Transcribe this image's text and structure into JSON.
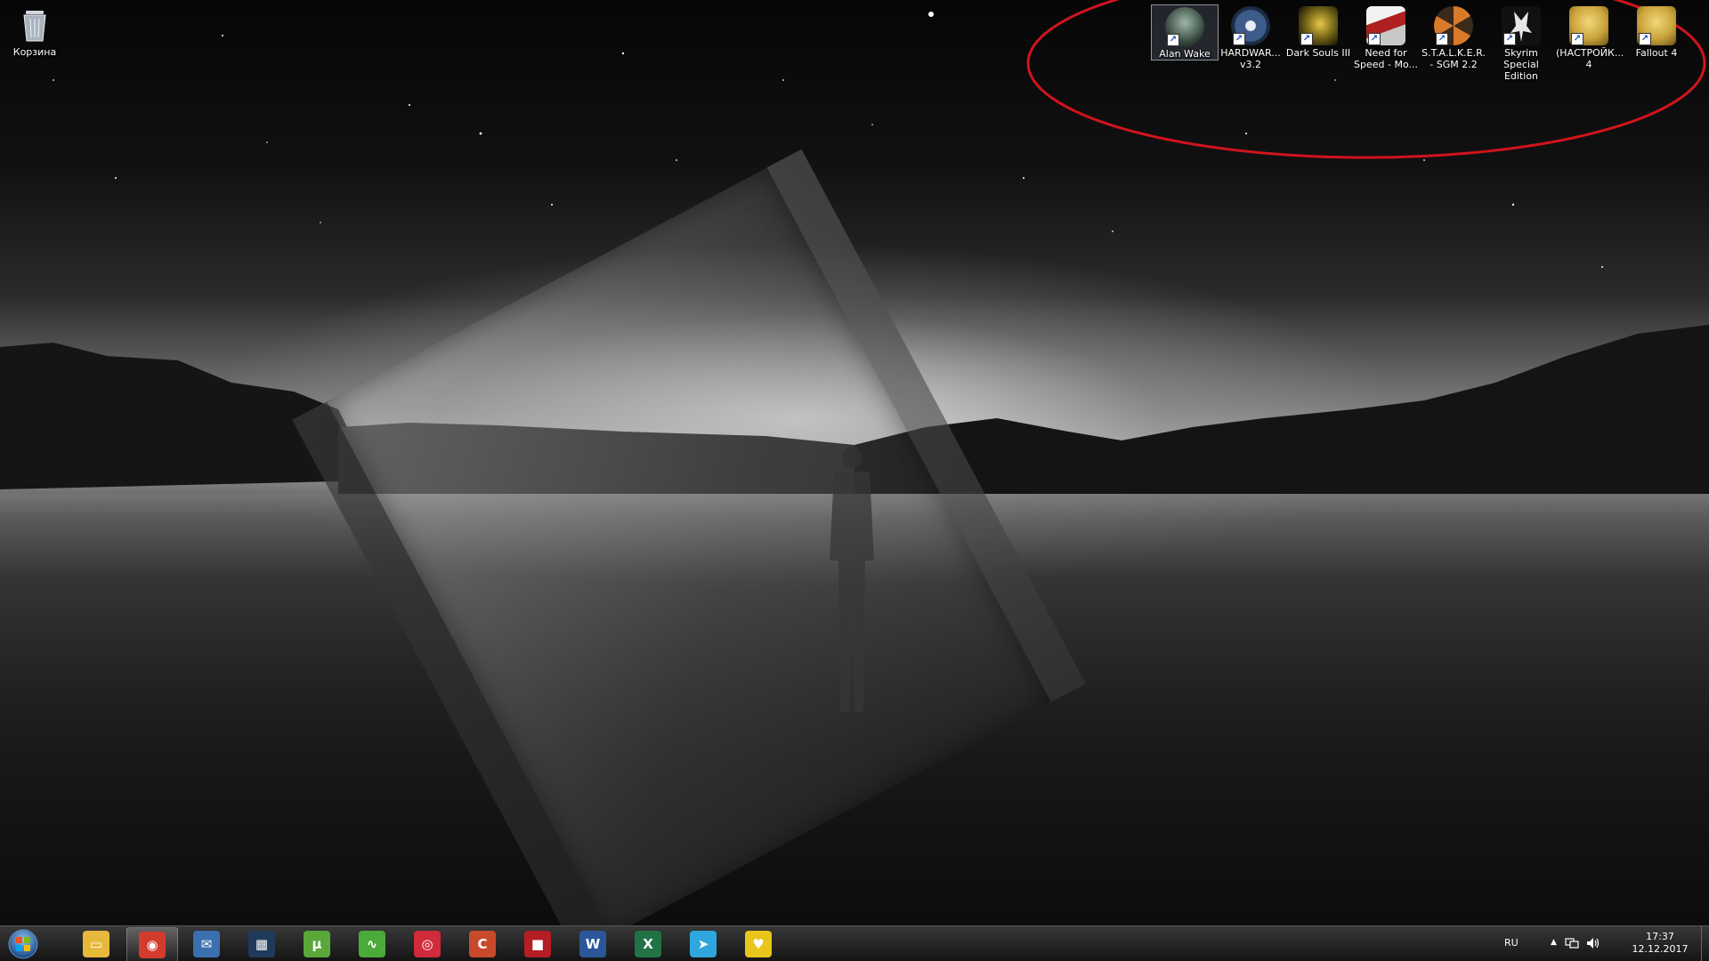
{
  "desktop": {
    "recycle_bin": {
      "label": "Корзина",
      "icon": "recycle-bin-icon"
    },
    "icons": [
      {
        "label": "Alan Wake",
        "icon": "alan-wake-icon",
        "color": "#5d7b6b",
        "selected": true
      },
      {
        "label": "HARDWAR... v3.2",
        "icon": "hardwar-icon",
        "color": "#3d5c8a",
        "selected": false
      },
      {
        "label": "Dark Souls III",
        "icon": "dark-souls-icon",
        "color": "#7a6a1a",
        "selected": false
      },
      {
        "label": "Need for Speed - Mo...",
        "icon": "need-for-speed-icon",
        "color": "#b02020",
        "selected": false
      },
      {
        "label": "S.T.A.L.K.E.R. - SGM 2.2",
        "icon": "stalker-icon",
        "color": "#8a5a2a",
        "selected": false
      },
      {
        "label": "Skyrim Special Edition",
        "icon": "skyrim-icon",
        "color": "#222222",
        "selected": false
      },
      {
        "label": "(НАСТРОЙК... 4",
        "icon": "fallout-settings-icon",
        "color": "#c9a43a",
        "selected": false
      },
      {
        "label": "Fallout 4",
        "icon": "fallout-4-icon",
        "color": "#c9a43a",
        "selected": false
      }
    ],
    "annotation_color": "#d0141c"
  },
  "taskbar": {
    "items": [
      {
        "name": "windows-explorer-icon",
        "color": "#e7b93b",
        "glyph": "▭",
        "active": false
      },
      {
        "name": "chrome-icon",
        "color": "#d33b2c",
        "glyph": "◉",
        "active": true
      },
      {
        "name": "thunderbird-icon",
        "color": "#3a6fb0",
        "glyph": "✉",
        "active": false
      },
      {
        "name": "media-player-icon",
        "color": "#1f3a5a",
        "glyph": "▦",
        "active": false
      },
      {
        "name": "utorrent-icon",
        "color": "#5aa83a",
        "glyph": "μ",
        "active": false
      },
      {
        "name": "green-app-icon",
        "color": "#4bab3a",
        "glyph": "∿",
        "active": false
      },
      {
        "name": "camera-app-icon",
        "color": "#d12a3a",
        "glyph": "◎",
        "active": false
      },
      {
        "name": "ccleaner-icon",
        "color": "#c84a2a",
        "glyph": "C",
        "active": false
      },
      {
        "name": "red-box-icon",
        "color": "#b51e25",
        "glyph": "■",
        "active": false
      },
      {
        "name": "word-icon",
        "color": "#2b579a",
        "glyph": "W",
        "active": false
      },
      {
        "name": "excel-icon",
        "color": "#217346",
        "glyph": "X",
        "active": false
      },
      {
        "name": "telegram-icon",
        "color": "#2ea6de",
        "glyph": "➤",
        "active": false
      },
      {
        "name": "yellow-app-icon",
        "color": "#e8c51a",
        "glyph": "♥",
        "active": false
      }
    ],
    "tray": {
      "language": "RU",
      "up_arrow": "▲",
      "time": "17:37",
      "date": "12.12.2017"
    }
  }
}
